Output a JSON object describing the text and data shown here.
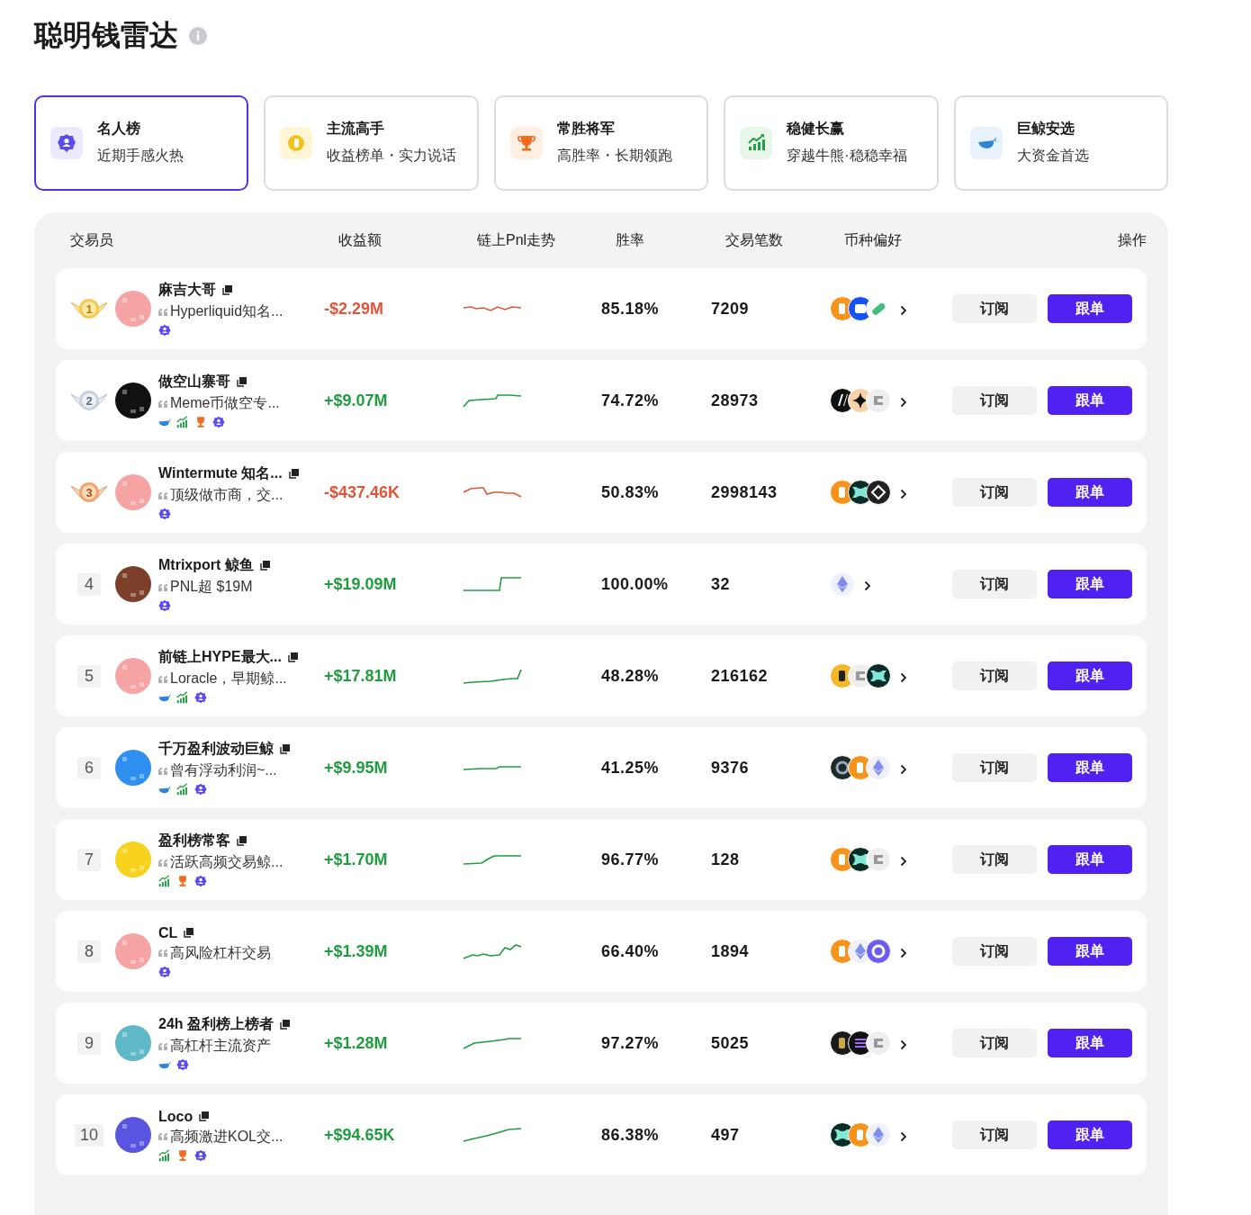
{
  "title": "聪明钱雷达",
  "categories": [
    {
      "kind": "badge",
      "title": "名人榜",
      "subtitle": "近期手感火热",
      "selected": true
    },
    {
      "kind": "coin",
      "title": "主流高手",
      "subtitle": "收益榜单・实力说话",
      "selected": false
    },
    {
      "kind": "trophy",
      "title": "常胜将军",
      "subtitle": "高胜率・长期领跑",
      "selected": false
    },
    {
      "kind": "chart",
      "title": "稳健长赢",
      "subtitle": "穿越牛熊·稳稳幸福",
      "selected": false
    },
    {
      "kind": "whale",
      "title": "巨鲸安选",
      "subtitle": "大资金首选",
      "selected": false
    }
  ],
  "table": {
    "columns": [
      "交易员",
      "收益额",
      "链上Pnl走势",
      "胜率",
      "交易笔数",
      "币种偏好",
      "操作"
    ],
    "rows": [
      {
        "rank": "1",
        "medal": {
          "kind": "gold"
        },
        "avatar": {
          "color": "#f5a3a3"
        },
        "name": "麻吉大哥",
        "bio": "Hyperliquid知名...",
        "tags": [
          {
            "kind": "badge"
          }
        ],
        "pnl": {
          "value": "-$2.29M",
          "kind": "loss"
        },
        "win_rate": "85.18%",
        "trades": "7209",
        "coins": [
          {
            "kind": "btc"
          },
          {
            "kind": "app"
          },
          {
            "kind": "pill"
          }
        ],
        "actions": [
          "订阅",
          "跟单"
        ]
      },
      {
        "rank": "2",
        "medal": {
          "kind": "silver"
        },
        "avatar": {
          "color": "#111111"
        },
        "name": "做空山寨哥",
        "bio": "Meme币做空专...",
        "tags": [
          {
            "kind": "whale"
          },
          {
            "kind": "chart"
          },
          {
            "kind": "trophy"
          },
          {
            "kind": "badge"
          }
        ],
        "pnl": {
          "value": "+$9.07M",
          "kind": "gain"
        },
        "win_rate": "74.72%",
        "trades": "28973",
        "coins": [
          {
            "kind": "slash"
          },
          {
            "kind": "star"
          },
          {
            "kind": "grey"
          }
        ],
        "actions": [
          "订阅",
          "跟单"
        ]
      },
      {
        "rank": "3",
        "medal": {
          "kind": "bronze"
        },
        "avatar": {
          "color": "#f5a3a3"
        },
        "name": "Wintermute 知名...",
        "bio": "顶级做市商，交...",
        "tags": [
          {
            "kind": "badge"
          }
        ],
        "pnl": {
          "value": "-$437.46K",
          "kind": "loss"
        },
        "win_rate": "50.83%",
        "trades": "2998143",
        "coins": [
          {
            "kind": "btc"
          },
          {
            "kind": "hyper"
          },
          {
            "kind": "sigma"
          }
        ],
        "actions": [
          "订阅",
          "跟单"
        ]
      },
      {
        "rank": "4",
        "avatar": {
          "color": "#7b3f2a"
        },
        "name": "Mtrixport 鲸鱼",
        "bio": "PNL超 $19M",
        "tags": [
          {
            "kind": "badge"
          }
        ],
        "pnl": {
          "value": "+$19.09M",
          "kind": "gain"
        },
        "win_rate": "100.00%",
        "trades": "32",
        "coins": [
          {
            "kind": "eth"
          }
        ],
        "actions": [
          "订阅",
          "跟单"
        ]
      },
      {
        "rank": "5",
        "avatar": {
          "color": "#f5a3a3"
        },
        "name": "前链上HYPE最大...",
        "bio": "Loracle，早期鲸...",
        "tags": [
          {
            "kind": "whale"
          },
          {
            "kind": "chart"
          },
          {
            "kind": "badge"
          }
        ],
        "pnl": {
          "value": "+$17.81M",
          "kind": "gain"
        },
        "win_rate": "48.28%",
        "trades": "216162",
        "coins": [
          {
            "kind": "zec"
          },
          {
            "kind": "grey"
          },
          {
            "kind": "hyper"
          }
        ],
        "actions": [
          "订阅",
          "跟单"
        ]
      },
      {
        "rank": "6",
        "avatar": {
          "color": "#2f8fef"
        },
        "name": "千万盈利波动巨鲸",
        "bio": "曾有浮动利润~...",
        "tags": [
          {
            "kind": "whale"
          },
          {
            "kind": "chart"
          },
          {
            "kind": "badge"
          }
        ],
        "pnl": {
          "value": "+$9.95M",
          "kind": "gain"
        },
        "win_rate": "41.25%",
        "trades": "9376",
        "coins": [
          {
            "kind": "ring-dark"
          },
          {
            "kind": "btc"
          },
          {
            "kind": "eth"
          }
        ],
        "actions": [
          "订阅",
          "跟单"
        ]
      },
      {
        "rank": "7",
        "avatar": {
          "color": "#f7d21e"
        },
        "name": "盈利榜常客",
        "bio": "活跃高频交易鲸...",
        "tags": [
          {
            "kind": "chart"
          },
          {
            "kind": "trophy"
          },
          {
            "kind": "badge"
          }
        ],
        "pnl": {
          "value": "+$1.70M",
          "kind": "gain"
        },
        "win_rate": "96.77%",
        "trades": "128",
        "coins": [
          {
            "kind": "btc"
          },
          {
            "kind": "hyper"
          },
          {
            "kind": "grey"
          }
        ],
        "actions": [
          "订阅",
          "跟单"
        ]
      },
      {
        "rank": "8",
        "avatar": {
          "color": "#f5a3a3"
        },
        "name": "CL",
        "bio": "高风险杠杆交易",
        "tags": [
          {
            "kind": "badge"
          }
        ],
        "pnl": {
          "value": "+$1.39M",
          "kind": "gain"
        },
        "win_rate": "66.40%",
        "trades": "1894",
        "coins": [
          {
            "kind": "btc"
          },
          {
            "kind": "eth"
          },
          {
            "kind": "ring"
          }
        ],
        "actions": [
          "订阅",
          "跟单"
        ]
      },
      {
        "rank": "9",
        "avatar": {
          "color": "#5fb8c8"
        },
        "name": "24h 盈利榜上榜者",
        "bio": "高杠杆主流资产",
        "tags": [
          {
            "kind": "whale"
          },
          {
            "kind": "badge"
          }
        ],
        "pnl": {
          "value": "+$1.28M",
          "kind": "gain"
        },
        "win_rate": "97.27%",
        "trades": "5025",
        "coins": [
          {
            "kind": "wings"
          },
          {
            "kind": "sol"
          },
          {
            "kind": "grey"
          }
        ],
        "actions": [
          "订阅",
          "跟单"
        ]
      },
      {
        "rank": "10",
        "avatar": {
          "color": "#5a55e0"
        },
        "name": "Loco",
        "bio": "高频激进KOL交...",
        "tags": [
          {
            "kind": "chart"
          },
          {
            "kind": "trophy"
          },
          {
            "kind": "badge"
          }
        ],
        "pnl": {
          "value": "+$94.65K",
          "kind": "gain"
        },
        "win_rate": "86.38%",
        "trades": "497",
        "coins": [
          {
            "kind": "hyper"
          },
          {
            "kind": "btc"
          },
          {
            "kind": "eth"
          }
        ],
        "actions": [
          "订阅",
          "跟单"
        ]
      }
    ]
  }
}
